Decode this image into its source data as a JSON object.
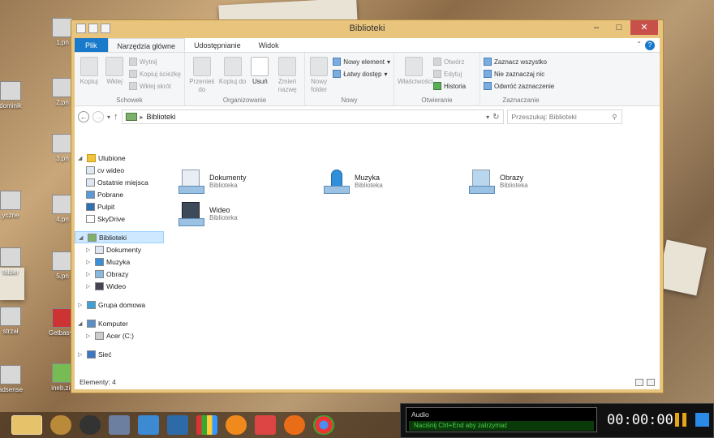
{
  "window": {
    "title": "Biblioteki"
  },
  "tabs": [
    "Plik",
    "Narzędzia główne",
    "Udostępnianie",
    "Widok"
  ],
  "ribbon": {
    "schowek": {
      "label": "Schowek",
      "kopiuj": "Kopiuj",
      "wklej": "Wklej",
      "wytnij": "Wytnij",
      "kopiuj_sciezke": "Kopiuj ścieżkę",
      "wklej_skrot": "Wklej skrót"
    },
    "organizowanie": {
      "label": "Organizowanie",
      "przenies": "Przenieś do",
      "kopiuj_do": "Kopiuj do",
      "usun": "Usuń",
      "zmien": "Zmień nazwę"
    },
    "nowy": {
      "label": "Nowy",
      "nowy_folder": "Nowy folder",
      "nowy_element": "Nowy element",
      "latwy_dostep": "Łatwy dostęp"
    },
    "otwieranie": {
      "label": "Otwieranie",
      "wlasciwosci": "Właściwości",
      "otworz": "Otwórz",
      "edytuj": "Edytuj",
      "historia": "Historia"
    },
    "zaznaczanie": {
      "label": "Zaznaczanie",
      "zaznacz": "Zaznacz wszystko",
      "nie_zaznaczaj": "Nie zaznaczaj nic",
      "odwroc": "Odwróć zaznaczenie"
    }
  },
  "address": {
    "path": "Biblioteki",
    "search_placeholder": "Przeszukaj: Biblioteki"
  },
  "nav": {
    "ulubione": "Ulubione",
    "fav_items": [
      "cv wideo",
      "Ostatnie miejsca",
      "Pobrane",
      "Pulpit",
      "SkyDrive"
    ],
    "biblioteki": "Biblioteki",
    "lib_items": [
      "Dokumenty",
      "Muzyka",
      "Obrazy",
      "Wideo"
    ],
    "grupa": "Grupa domowa",
    "komputer": "Komputer",
    "acer": "Acer (C:)",
    "siec": "Sieć"
  },
  "files": [
    {
      "name": "Dokumenty",
      "type": "Biblioteka"
    },
    {
      "name": "Muzyka",
      "type": "Biblioteka"
    },
    {
      "name": "Obrazy",
      "type": "Biblioteka"
    },
    {
      "name": "Wideo",
      "type": "Biblioteka"
    }
  ],
  "status": {
    "count": "Elementy: 4"
  },
  "recorder": {
    "audio": "Audio",
    "hint": "Naciśnij Ctrl+End aby zatrzymać",
    "time": "00:00:00"
  },
  "desktop": [
    "1.pn",
    "2.pn",
    "3.pn",
    "4.pn",
    "5.pn",
    "folder",
    "Getbasyp",
    "ineb.zip",
    "adsense",
    "dominik",
    "yczne",
    "eb",
    "strzał"
  ]
}
